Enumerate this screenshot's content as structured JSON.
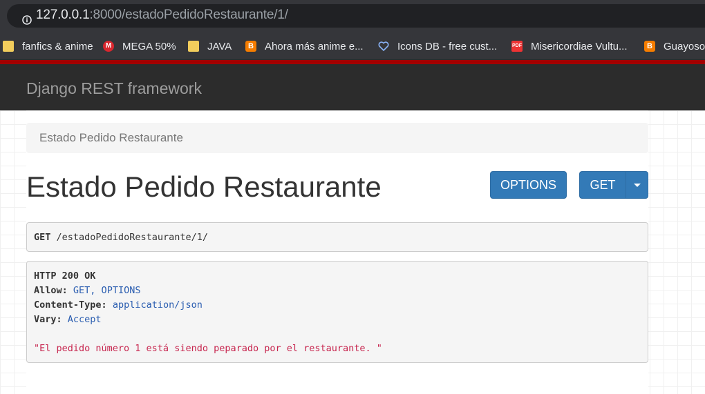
{
  "browser": {
    "url_host": "127.0.0.1",
    "url_rest": ":8000/estadoPedidoRestaurante/1/",
    "bookmarks": [
      {
        "label": "fanfics & anime",
        "icon": "folder-icon"
      },
      {
        "label": "MEGA 50%",
        "icon": "mega-icon"
      },
      {
        "label": "JAVA",
        "icon": "folder-icon"
      },
      {
        "label": "Ahora más anime e...",
        "icon": "blogger-icon"
      },
      {
        "label": "Icons DB - free cust...",
        "icon": "heart-icon"
      },
      {
        "label": "Misericordiae Vultu...",
        "icon": "pdf-icon"
      },
      {
        "label": "Guayosof",
        "icon": "blogger-icon"
      }
    ]
  },
  "navbar": {
    "brand": "Django REST framework"
  },
  "breadcrumb": {
    "item": "Estado Pedido Restaurante"
  },
  "page": {
    "title": "Estado Pedido Restaurante"
  },
  "buttons": {
    "options": "OPTIONS",
    "get": "GET"
  },
  "request": {
    "method": "GET",
    "path": "/estadoPedidoRestaurante/1/"
  },
  "response": {
    "status": "HTTP 200 OK",
    "headers": [
      {
        "name": "Allow:",
        "value": "GET, OPTIONS"
      },
      {
        "name": "Content-Type:",
        "value": "application/json"
      },
      {
        "name": "Vary:",
        "value": "Accept"
      }
    ],
    "body": "\"El pedido número 1 está siendo peparado por el restaurante. \""
  },
  "colors": {
    "primary": "#337ab7",
    "navbar": "#2c2c2c",
    "stripe": "#a30000",
    "string": "#c7254e"
  }
}
